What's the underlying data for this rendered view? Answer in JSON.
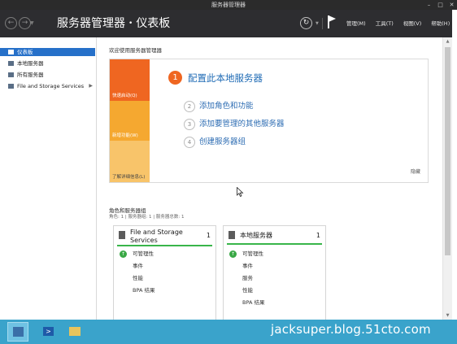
{
  "window": {
    "title": "服务器管理器",
    "controls": [
      "–",
      "□",
      "✕"
    ]
  },
  "header": {
    "breadcrumb_root": "服务器管理器",
    "breadcrumb_sep": "•",
    "breadcrumb_page": "仪表板",
    "back_symbol": "←",
    "forward_symbol": "→",
    "refresh_symbol": "↻",
    "menu": [
      "管理(M)",
      "工具(T)",
      "视图(V)",
      "帮助(H)"
    ]
  },
  "sidebar": {
    "items": [
      {
        "label": "仪表板",
        "active": true
      },
      {
        "label": "本地服务器"
      },
      {
        "label": "所有服务器"
      },
      {
        "label": "File and Storage Services",
        "has_arrow": true
      }
    ]
  },
  "welcome": {
    "title": "欢迎使用服务器管理器",
    "tabs": [
      "快速启动(Q)",
      "新增功能(W)",
      "了解详细信息(L)"
    ],
    "steps": [
      {
        "num": "1",
        "label": "配置此本地服务器"
      },
      {
        "num": "2",
        "label": "添加角色和功能"
      },
      {
        "num": "3",
        "label": "添加要管理的其他服务器"
      },
      {
        "num": "4",
        "label": "创建服务器组"
      }
    ],
    "hide": "隐藏"
  },
  "roles": {
    "title": "角色和服务器组",
    "subtitle": "角色: 1 | 服务器组: 1 | 服务器总数: 1",
    "cards": [
      {
        "title": "File and Storage Services",
        "count": "1",
        "items": [
          "可管理性",
          "事件",
          "性能",
          "BPA 结果"
        ]
      },
      {
        "title": "本地服务器",
        "count": "1",
        "items": [
          "可管理性",
          "事件",
          "服务",
          "性能",
          "BPA 结果"
        ]
      }
    ]
  },
  "taskbar": {
    "watermark": "jacksuper.blog.51cto.com"
  },
  "colors": {
    "header_bg": "#2d2d30",
    "accent_orange": "#ef6621",
    "tab_new": "#f5a830",
    "tab_learn": "#f8c46a",
    "link_blue": "#1f6bb5",
    "status_green": "#39b54a",
    "taskbar": "#3aa3cb"
  }
}
